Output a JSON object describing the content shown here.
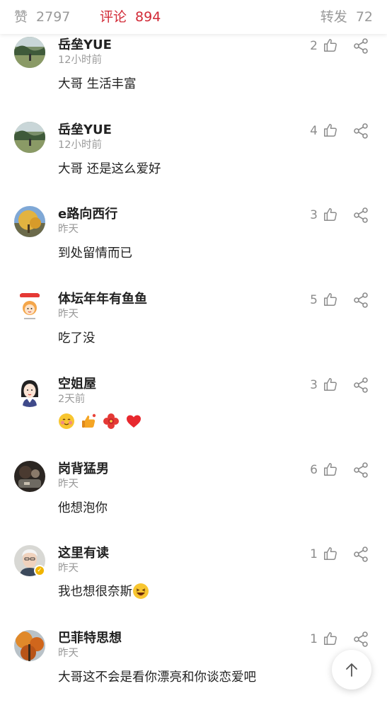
{
  "topbar": {
    "like_label": "赞",
    "like_count": "2797",
    "comment_label": "评论",
    "comment_count": "894",
    "repost_label": "转发",
    "repost_count": "72"
  },
  "colors": {
    "accent": "#d22a37",
    "secondary": "#9a9a9a",
    "text": "#222222"
  },
  "comments": [
    {
      "name": "岳垒YUE",
      "time": "12小时前",
      "text": "大哥 生活丰富",
      "likes": "2",
      "avatar": "landscape"
    },
    {
      "name": "岳垒YUE",
      "time": "12小时前",
      "text": "大哥 还是这么爱好",
      "likes": "4",
      "avatar": "landscape"
    },
    {
      "name": "e路向西行",
      "time": "昨天",
      "text": "到处留情而已",
      "likes": "3",
      "avatar": "autumn-tree"
    },
    {
      "name": "体坛年年有鱼鱼",
      "time": "昨天",
      "text": "吃了没",
      "likes": "5",
      "avatar": "cartoon-girl"
    },
    {
      "name": "空姐屋",
      "time": "2天前",
      "text": "",
      "likes": "3",
      "avatar": "cartoon-stewardess",
      "emojis": [
        "smiling-face-emoji",
        "thumbs-up-emoji",
        "flower-emoji",
        "red-heart-emoji"
      ]
    },
    {
      "name": "岗背猛男",
      "time": "昨天",
      "text": "他想泡你",
      "likes": "6",
      "avatar": "dark-photo"
    },
    {
      "name": "这里有读",
      "time": "昨天",
      "text": "我也想很奈斯",
      "likes": "1",
      "avatar": "old-man",
      "emojis": [
        "laughing-face-emoji"
      ]
    },
    {
      "name": "巴菲特思想",
      "time": "昨天",
      "text": "大哥这不会是看你漂亮和你谈恋爱吧",
      "likes": "1",
      "avatar": "autumn-leaves"
    }
  ]
}
